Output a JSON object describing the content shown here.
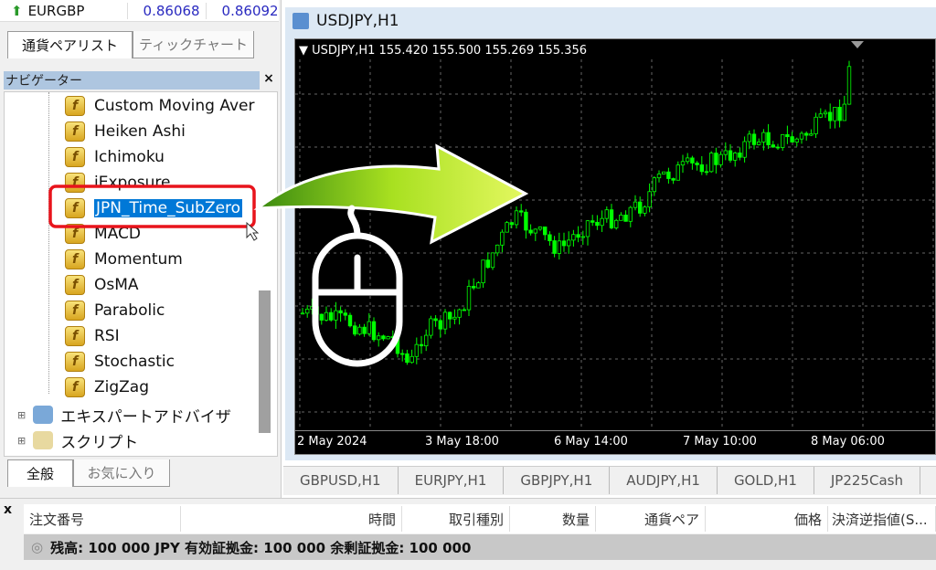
{
  "market_watch": {
    "symbol": "EURGBP",
    "bid": "0.86068",
    "ask": "0.86092",
    "icon": "up-arrow-icon"
  },
  "left_tabs": [
    "通貨ペアリスト",
    "ティックチャート"
  ],
  "navigator": {
    "title": "ナビゲーター",
    "close": "×",
    "items": [
      "Custom Moving Aver",
      "Heiken Ashi",
      "Ichimoku",
      "iExposure",
      "JPN_Time_SubZero",
      "MACD",
      "Momentum",
      "OsMA",
      "Parabolic",
      "RSI",
      "Stochastic",
      "ZigZag"
    ],
    "selected": "JPN_Time_SubZero",
    "groups": [
      "エキスパートアドバイザ",
      "スクリプト"
    ]
  },
  "nav_tabs": [
    "全般",
    "お気に入り"
  ],
  "chart": {
    "window_title": "USDJPY,H1",
    "info": "USDJPY,H1  155.420 155.500 155.269 155.356",
    "time_labels": [
      "2 May 2024",
      "3 May 18:00",
      "6 May 14:00",
      "7 May 10:00",
      "8 May 06:00"
    ],
    "candle_color": "#00ff00"
  },
  "chart_tabs": [
    "GBPUSD,H1",
    "EURJPY,H1",
    "GBPJPY,H1",
    "AUDJPY,H1",
    "GOLD,H1",
    "JP225Cash"
  ],
  "terminal": {
    "close": "x",
    "columns": [
      "注文番号",
      "時間",
      "取引種別",
      "数量",
      "通貨ペア",
      "価格",
      "決済逆指値(S..."
    ],
    "balance": "残高: 100 000 JPY  有効証拠金: 100 000  余剰証拠金: 100 000"
  },
  "highlight_color": "#e8141c"
}
